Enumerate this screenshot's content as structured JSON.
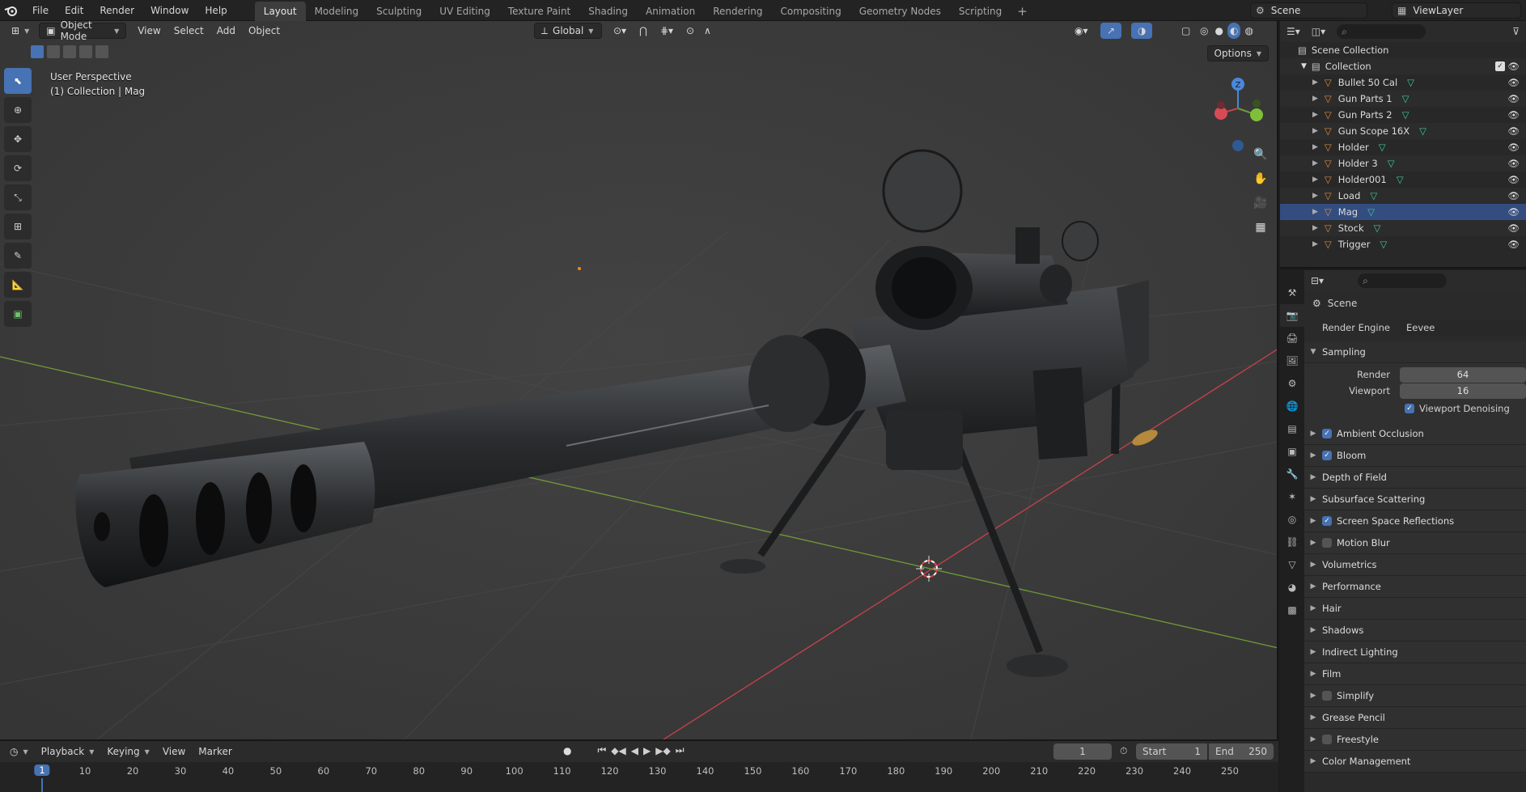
{
  "topbar": {
    "menus": [
      "File",
      "Edit",
      "Render",
      "Window",
      "Help"
    ],
    "workspaces": [
      "Layout",
      "Modeling",
      "Sculpting",
      "UV Editing",
      "Texture Paint",
      "Shading",
      "Animation",
      "Rendering",
      "Compositing",
      "Geometry Nodes",
      "Scripting"
    ],
    "active_workspace": "Layout",
    "add_tab": "+",
    "scene_name": "Scene",
    "view_layer": "ViewLayer"
  },
  "viewport": {
    "mode": "Object Mode",
    "menus": [
      "View",
      "Select",
      "Add",
      "Object"
    ],
    "transform_orientation": "Global",
    "options_label": "Options",
    "overlay_line1": "User Perspective",
    "overlay_line2": "(1) Collection | Mag",
    "gizmo_axis_label": "Z"
  },
  "outliner": {
    "scene_collection": "Scene Collection",
    "collection": "Collection",
    "objects": [
      "Bullet 50 Cal",
      "Gun Parts 1",
      "Gun Parts 2",
      "Gun Scope 16X",
      "Holder",
      "Holder 3",
      "Holder001",
      "Load",
      "Mag",
      "Stock",
      "Trigger"
    ],
    "selected": "Mag"
  },
  "properties": {
    "context": "Scene",
    "render_engine_label": "Render Engine",
    "render_engine_value": "Eevee",
    "sampling_label": "Sampling",
    "render_label": "Render",
    "render_value": "64",
    "viewport_label": "Viewport",
    "viewport_value": "16",
    "viewport_denoising_label": "Viewport Denoising",
    "panels": [
      {
        "label": "Ambient Occlusion",
        "checkbox": true,
        "checked": true
      },
      {
        "label": "Bloom",
        "checkbox": true,
        "checked": true
      },
      {
        "label": "Depth of Field",
        "checkbox": false
      },
      {
        "label": "Subsurface Scattering",
        "checkbox": false
      },
      {
        "label": "Screen Space Reflections",
        "checkbox": true,
        "checked": true
      },
      {
        "label": "Motion Blur",
        "checkbox": true,
        "checked": false
      },
      {
        "label": "Volumetrics",
        "checkbox": false
      },
      {
        "label": "Performance",
        "checkbox": false
      },
      {
        "label": "Hair",
        "checkbox": false
      },
      {
        "label": "Shadows",
        "checkbox": false
      },
      {
        "label": "Indirect Lighting",
        "checkbox": false
      },
      {
        "label": "Film",
        "checkbox": false
      },
      {
        "label": "Simplify",
        "checkbox": true,
        "checked": false
      },
      {
        "label": "Grease Pencil",
        "checkbox": false
      },
      {
        "label": "Freestyle",
        "checkbox": true,
        "checked": false
      },
      {
        "label": "Color Management",
        "checkbox": false
      }
    ]
  },
  "timeline": {
    "menus": [
      "Playback",
      "Keying",
      "View",
      "Marker"
    ],
    "current_frame": "1",
    "start_label": "Start",
    "start_value": "1",
    "end_label": "End",
    "end_value": "250",
    "ticks": [
      "1",
      "10",
      "20",
      "30",
      "40",
      "50",
      "60",
      "70",
      "80",
      "90",
      "100",
      "110",
      "120",
      "130",
      "140",
      "150",
      "160",
      "170",
      "180",
      "190",
      "200",
      "210",
      "220",
      "230",
      "240",
      "250"
    ]
  },
  "colors": {
    "accent": "#4772b3",
    "axis_x": "#c8424c",
    "axis_y": "#6f9a38",
    "object_icon": "#e08a3c",
    "mesh_icon": "#3fc79a"
  }
}
